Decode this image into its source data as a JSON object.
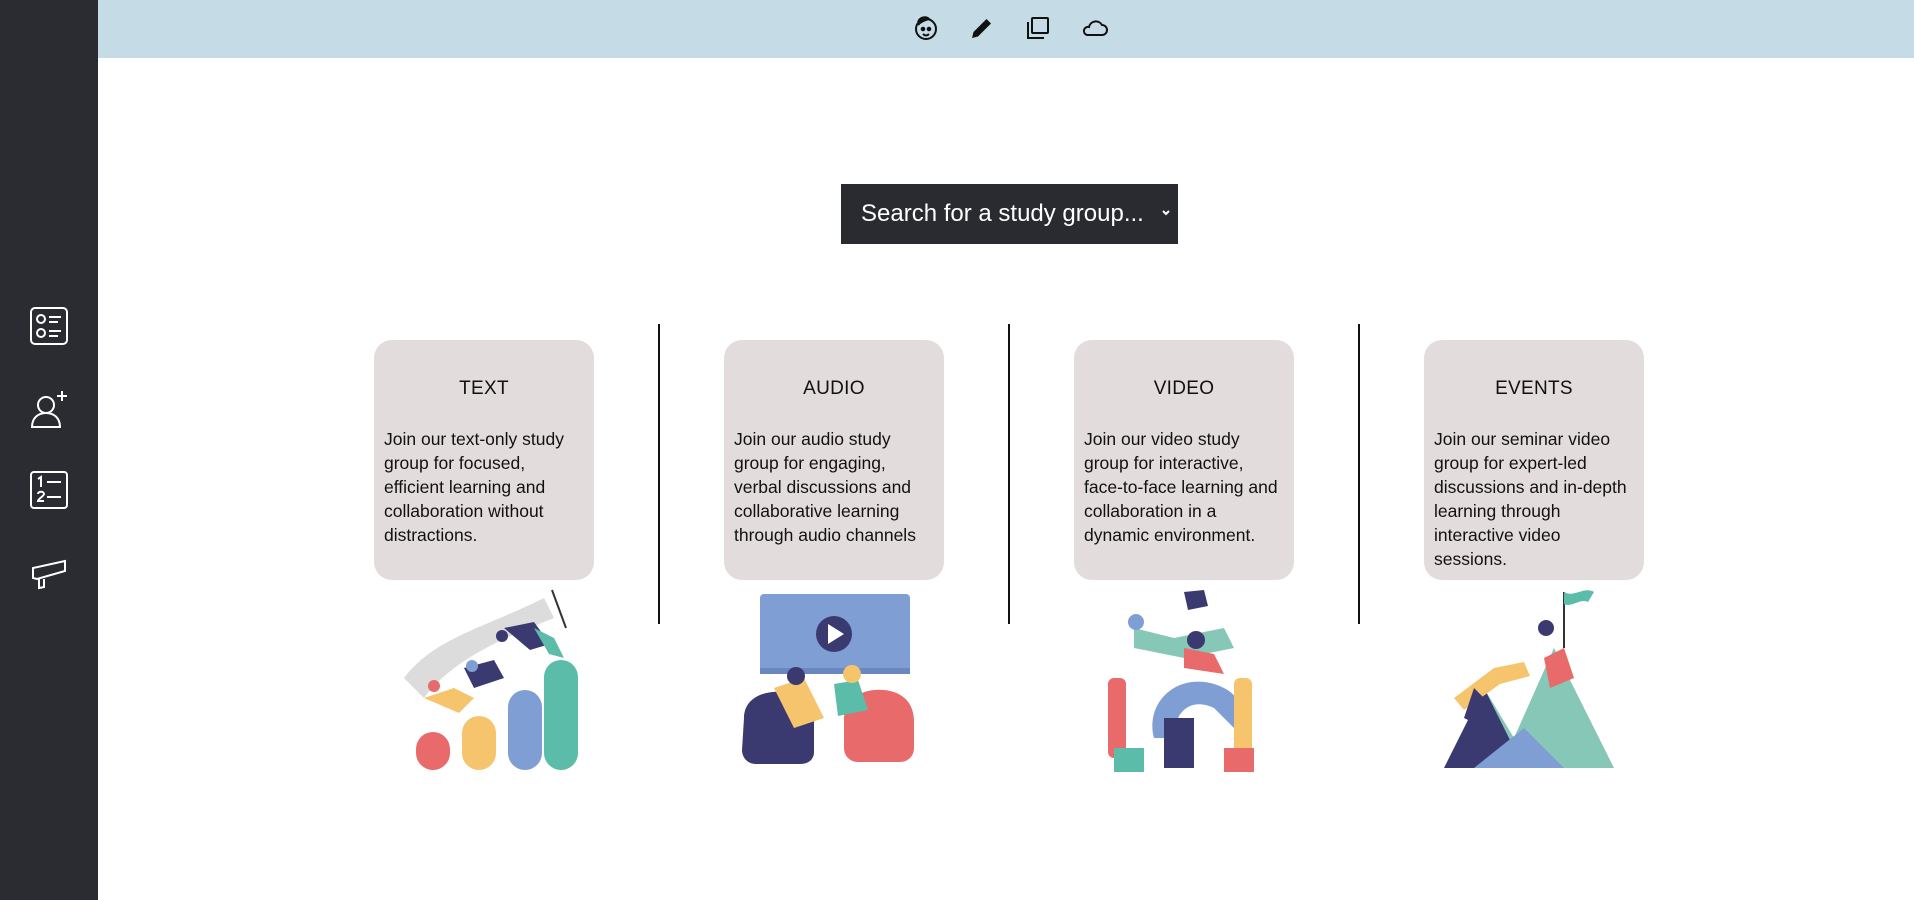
{
  "search": {
    "placeholder": "Search for a study group..."
  },
  "cards": [
    {
      "title": "TEXT",
      "description": "Join our text-only study group for focused, efficient learning and collaboration without distractions."
    },
    {
      "title": "AUDIO",
      "description": "Join our audio study group for engaging, verbal discussions and collaborative learning through audio channels"
    },
    {
      "title": "VIDEO",
      "description": "Join our video study group for interactive, face-to-face learning and collaboration in a dynamic environment."
    },
    {
      "title": "EVENTS",
      "description": "Join our seminar video group for expert-led discussions and in-depth learning through interactive video sessions."
    }
  ],
  "icons": {
    "top": [
      "face-icon",
      "pencil-icon",
      "folders-icon",
      "cloud-icon"
    ],
    "sidebar": [
      "checklist-icon",
      "add-user-icon",
      "numbered-list-icon",
      "megaphone-icon"
    ]
  },
  "colors": {
    "sidebar": "#2b2c31",
    "topbar": "#c5dbe6",
    "card": "#e3dcdc",
    "search": "#2a2b30"
  }
}
